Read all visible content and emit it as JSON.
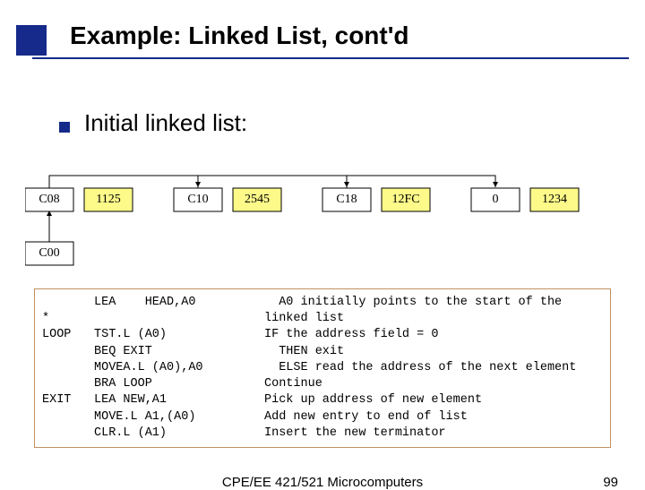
{
  "title": "Example: Linked List, cont'd",
  "subhead": "Initial linked list:",
  "nodes": [
    {
      "addr": "C08",
      "data": "1125"
    },
    {
      "addr": "C10",
      "data": "2545"
    },
    {
      "addr": "C18",
      "data": "12FC"
    },
    {
      "addr": "0",
      "data": "1234"
    }
  ],
  "head": "C00",
  "code": [
    {
      "label": "",
      "op": "LEA    HEAD,A0",
      "c": "  A0 initially points to the start of the"
    },
    {
      "label": "*",
      "op": "",
      "c": "linked list"
    },
    {
      "label": "LOOP",
      "op": "TST.L (A0)",
      "c": "IF the address field = 0"
    },
    {
      "label": "",
      "op": "BEQ EXIT",
      "c": "  THEN exit"
    },
    {
      "label": "",
      "op": "MOVEA.L (A0),A0",
      "c": "  ELSE read the address of the next element"
    },
    {
      "label": "",
      "op": "BRA LOOP",
      "c": "Continue"
    },
    {
      "label": "EXIT",
      "op": "LEA NEW,A1",
      "c": "Pick up address of new element"
    },
    {
      "label": "",
      "op": "MOVE.L A1,(A0)",
      "c": "Add new entry to end of list"
    },
    {
      "label": "",
      "op": "CLR.L (A1)",
      "c": "Insert the new terminator"
    }
  ],
  "footer_center": "CPE/EE 421/521 Microcomputers",
  "footer_right": "99"
}
